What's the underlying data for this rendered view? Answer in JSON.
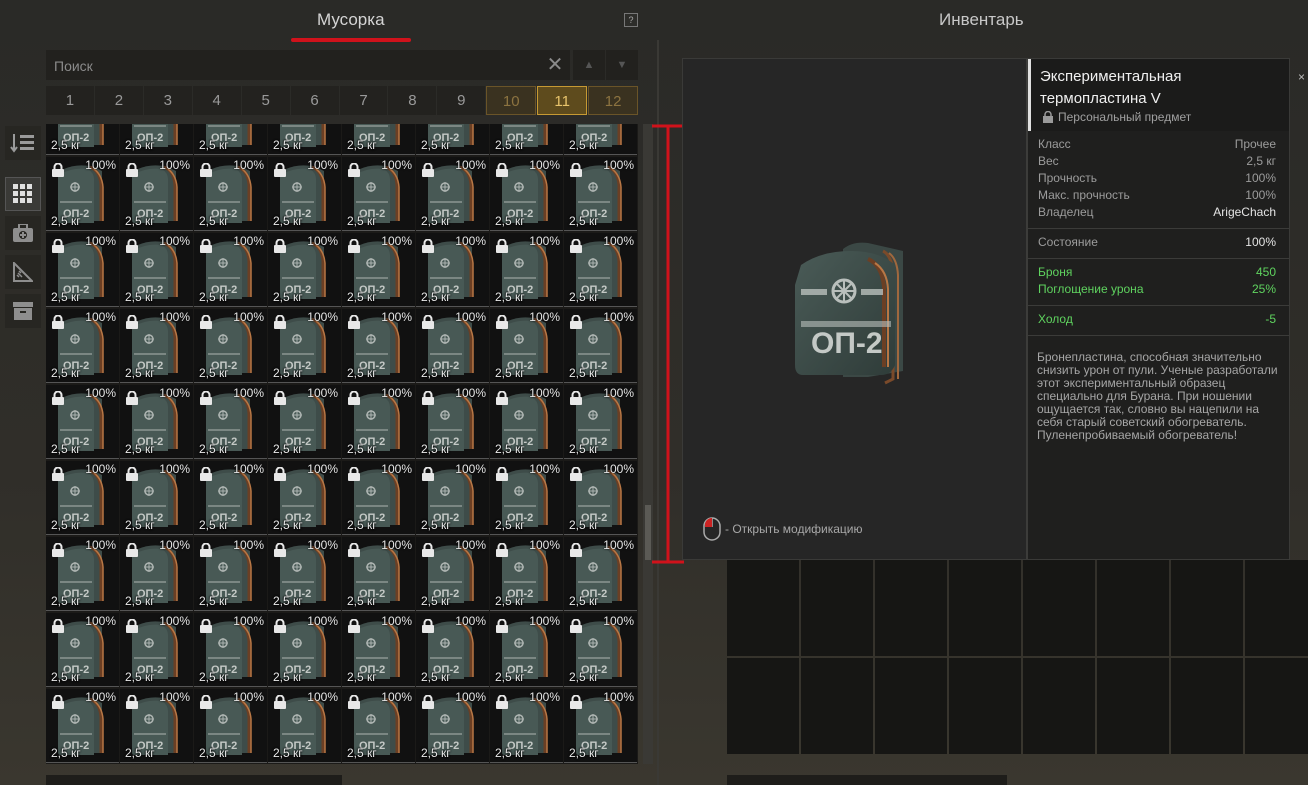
{
  "tabs": {
    "trash": "Мусорка",
    "inventory": "Инвентарь",
    "help": "?"
  },
  "search": {
    "placeholder": "Поиск",
    "clear": "✕",
    "up": "▲",
    "down": "▼"
  },
  "pages": [
    "1",
    "2",
    "3",
    "4",
    "5",
    "6",
    "7",
    "8",
    "9",
    "10",
    "11",
    "12"
  ],
  "active_page": "11",
  "sidebar": [
    "sort-icon",
    "grid-view-icon",
    "camera-box-icon",
    "ruler-triangle-icon",
    "archive-icon"
  ],
  "item_cell": {
    "durability": "100%",
    "weight": "2,5 кг"
  },
  "tooltip": {
    "title": "Экспериментальная термопластина V",
    "personal": "Персональный предмет",
    "stats": [
      {
        "k": "Класс",
        "v": "Прочее"
      },
      {
        "k": "Вес",
        "v": "2,5 кг"
      },
      {
        "k": "Прочность",
        "v": "100%"
      },
      {
        "k": "Макс. прочность",
        "v": "100%"
      },
      {
        "k": "Владелец",
        "v": "ArigeChach"
      }
    ],
    "condition": {
      "k": "Состояние",
      "v": "100%"
    },
    "armor": {
      "k": "Броня",
      "v": "450"
    },
    "absorb": {
      "k": "Поглощение урона",
      "v": "25%"
    },
    "cold": {
      "k": "Холод",
      "v": "-5"
    },
    "description": "Бронепластина, способная значительно снизить урон от пули. Ученые разработали этот экспериментальный образец специально для Бурана. При ношении ощущается так, словно вы нацепили на себя старый советский обогреватель. Пуленепробиваемый обогреватель!",
    "hint": "- Открыть модификацию",
    "plate_label": "ОП-2"
  },
  "colors": {
    "accent_red": "#d0121b",
    "gold": "#c79a33",
    "green": "#5fd35f"
  }
}
